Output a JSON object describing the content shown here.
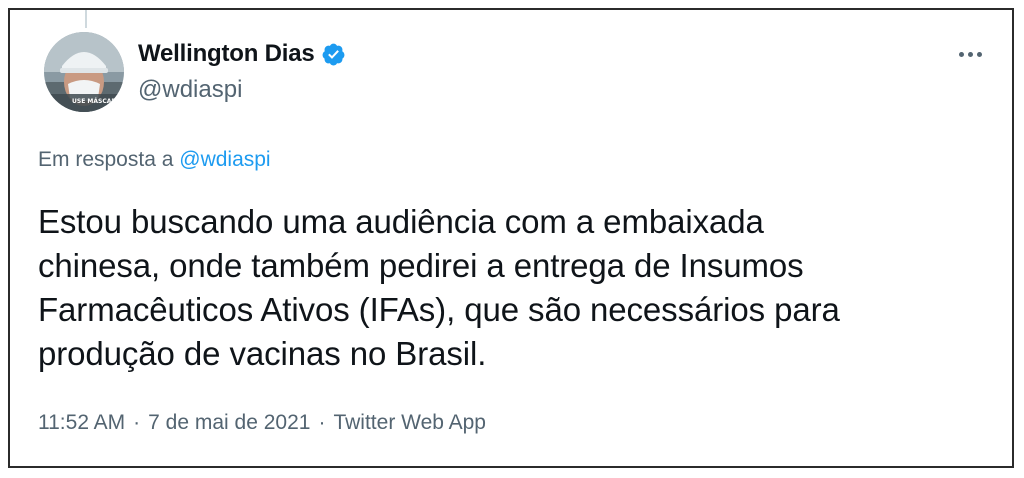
{
  "author": {
    "display_name": "Wellington Dias",
    "handle": "@wdiaspi",
    "verified": true,
    "avatar_badge": "USE MÁSCARA"
  },
  "reply": {
    "prefix": "Em resposta a",
    "target": "@wdiaspi"
  },
  "tweet": {
    "lines": [
      "Estou buscando uma audiência com a embaixada",
      "chinesa, onde também pedirei a entrega de Insumos",
      "Farmacêuticos Ativos (IFAs), que são necessários para",
      "produção de vacinas no Brasil."
    ]
  },
  "meta": {
    "time": "11:52 AM",
    "separator": "·",
    "date": "7 de mai de 2021",
    "source": "Twitter Web App"
  },
  "icons": {
    "verified": "verified-badge-icon",
    "more": "more-options-icon"
  },
  "colors": {
    "link": "#1d9bf0",
    "secondary_text": "#536471",
    "primary_text": "#0f1419",
    "verified": "#1d9bf0"
  }
}
